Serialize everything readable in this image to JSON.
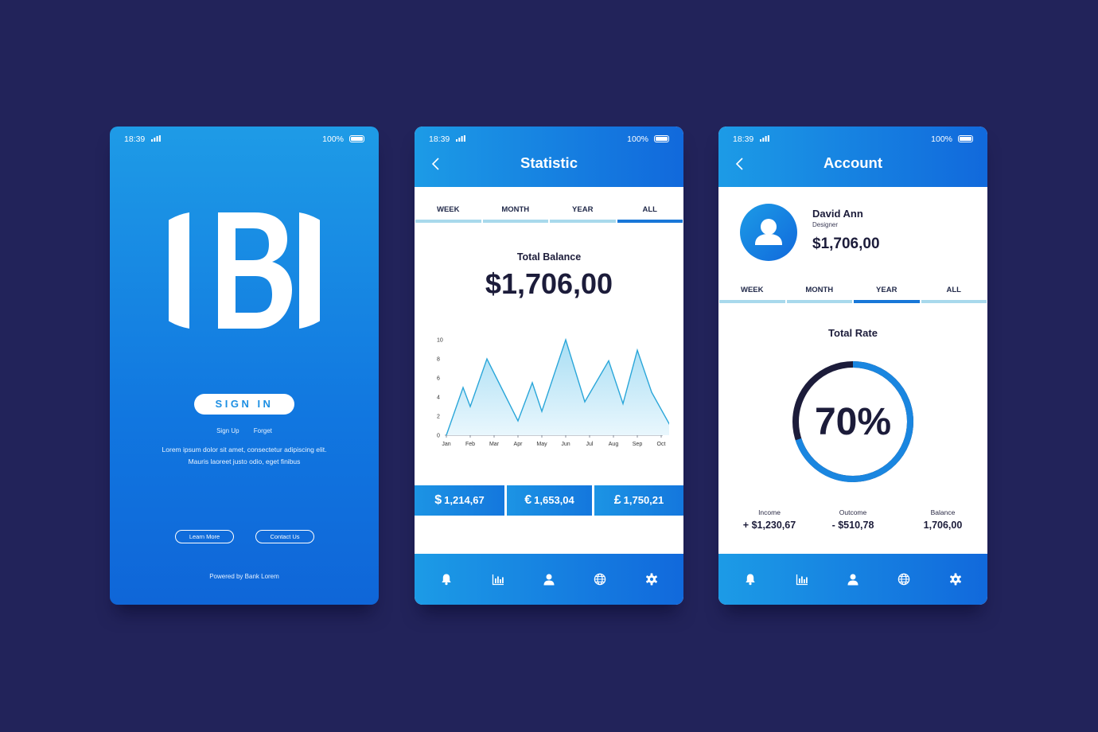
{
  "status": {
    "time": "18:39",
    "battery": "100%"
  },
  "login": {
    "signin_label": "SIGN IN",
    "signup_label": "Sign Up",
    "forget_label": "Forget",
    "lorem_line1": "Lorem ipsum dolor sit amet, consectetur adipiscing elit.",
    "lorem_line2": "Mauris laoreet justo odio, eget finibus",
    "learn_more": "Learn More",
    "contact_us": "Contact Us",
    "powered_by": "Powered by Bank Lorem"
  },
  "statistic": {
    "title": "Statistic",
    "tabs": [
      "WEEK",
      "MONTH",
      "YEAR",
      "ALL"
    ],
    "active_tab": "ALL",
    "balance_label": "Total Balance",
    "balance_value": "$1,706,00",
    "currencies": [
      {
        "symbol": "$",
        "amount": "1,214,67"
      },
      {
        "symbol": "€",
        "amount": "1,653,04"
      },
      {
        "symbol": "£",
        "amount": "1,750,21"
      }
    ]
  },
  "chart_data": {
    "type": "area",
    "categories": [
      "Jan",
      "Feb",
      "Mar",
      "Apr",
      "May",
      "Jun",
      "Jul",
      "Aug",
      "Sep",
      "Oct"
    ],
    "x": [
      0,
      0.7,
      1.0,
      1.7,
      3.0,
      3.6,
      4.0,
      5.0,
      5.8,
      6.8,
      7.4,
      8.0,
      8.6,
      9.6
    ],
    "y": [
      0,
      5,
      3,
      8,
      1.5,
      5.5,
      2.5,
      10,
      3.5,
      7.8,
      3.3,
      8.9,
      4.5,
      0
    ],
    "yticks": [
      0,
      2,
      4,
      6,
      8,
      10
    ],
    "ylim": [
      0,
      10
    ],
    "title": "",
    "xlabel": "",
    "ylabel": "",
    "grid": false,
    "colors": {
      "line": "#2aa6d9",
      "fill_top": "#a9def4",
      "fill_bottom": "#e9f7fd"
    }
  },
  "account": {
    "title": "Account",
    "name": "David Ann",
    "role": "Designer",
    "balance": "$1,706,00",
    "tabs": [
      "WEEK",
      "MONTH",
      "YEAR",
      "ALL"
    ],
    "active_tab": "YEAR",
    "rate_label": "Total Rate",
    "rate_value": "70%",
    "rate_fraction": 0.7,
    "stats": [
      {
        "label": "Income",
        "value": "+ $1,230,67"
      },
      {
        "label": "Outcome",
        "value": "- $510,78"
      },
      {
        "label": "Balance",
        "value": "1,706,00"
      }
    ]
  },
  "nav_icons": [
    "bell-icon",
    "bar-chart-icon",
    "user-icon",
    "globe-icon",
    "gear-icon"
  ],
  "colors": {
    "background": "#22235a",
    "accent": "#1877d8",
    "dark_text": "#1c1c3a"
  }
}
